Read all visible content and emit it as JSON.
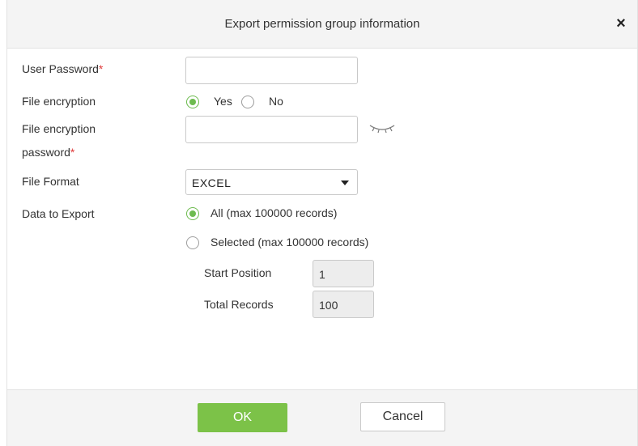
{
  "dialog": {
    "title": "Export permission group information",
    "close_symbol": "×"
  },
  "form": {
    "user_password": {
      "label": "User Password",
      "required_mark": "*",
      "value": ""
    },
    "file_encryption": {
      "label": "File encryption",
      "options": [
        "Yes",
        "No"
      ],
      "selected": "Yes"
    },
    "file_encryption_password": {
      "label_line1": "File encryption",
      "label_line2": "password",
      "required_mark": "*",
      "value": "",
      "toggle_icon": "eye-closed-icon"
    },
    "file_format": {
      "label": "File Format",
      "selected": "EXCEL"
    },
    "data_to_export": {
      "label": "Data to Export",
      "option_all": "All (max 100000 records)",
      "option_selected": "Selected (max 100000 records)",
      "selected": "All",
      "start_position": {
        "label": "Start Position",
        "value": "1"
      },
      "total_records": {
        "label": "Total Records",
        "value": "100"
      }
    }
  },
  "footer": {
    "ok_label": "OK",
    "cancel_label": "Cancel"
  },
  "colors": {
    "accent": "#7cc248",
    "radio_checked": "#6dbb4f",
    "required": "#e03b3b",
    "header_bg": "#f4f4f4"
  }
}
